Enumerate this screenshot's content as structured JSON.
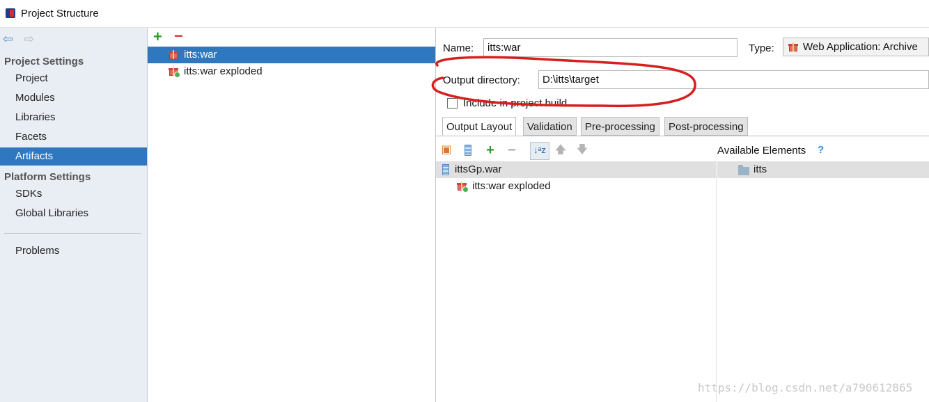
{
  "window": {
    "title": "Project Structure"
  },
  "sidebar": {
    "project_settings_heading": "Project Settings",
    "project_items": [
      "Project",
      "Modules",
      "Libraries",
      "Facets",
      "Artifacts"
    ],
    "selected_item": "Artifacts",
    "platform_settings_heading": "Platform Settings",
    "platform_items": [
      "SDKs",
      "Global Libraries"
    ],
    "problems_label": "Problems"
  },
  "artifacts": {
    "add_label": "+",
    "remove_label": "−",
    "items": [
      {
        "name": "itts:war",
        "selected": true
      },
      {
        "name": "itts:war exploded",
        "selected": false
      }
    ]
  },
  "details": {
    "name_label": "Name:",
    "name_value": "itts:war",
    "type_label": "Type:",
    "type_value": "Web Application: Archive",
    "output_dir_label": "Output directory:",
    "output_dir_value": "D:\\itts\\target",
    "include_build_label": "Include in project build",
    "include_build_checked": false,
    "tabs": [
      "Output Layout",
      "Validation",
      "Pre-processing",
      "Post-processing"
    ],
    "active_tab": "Output Layout",
    "available_elements_label": "Available Elements",
    "help_label": "?",
    "layout_tree": {
      "root": "ittsGp.war",
      "child": "itts:war exploded"
    },
    "available_tree": {
      "root": "itts"
    }
  },
  "watermark": "https://blog.csdn.net/a790612865",
  "colors": {
    "selection": "#2f78bf",
    "sidebar_bg": "#e9eef4",
    "annotation": "#d62020"
  }
}
